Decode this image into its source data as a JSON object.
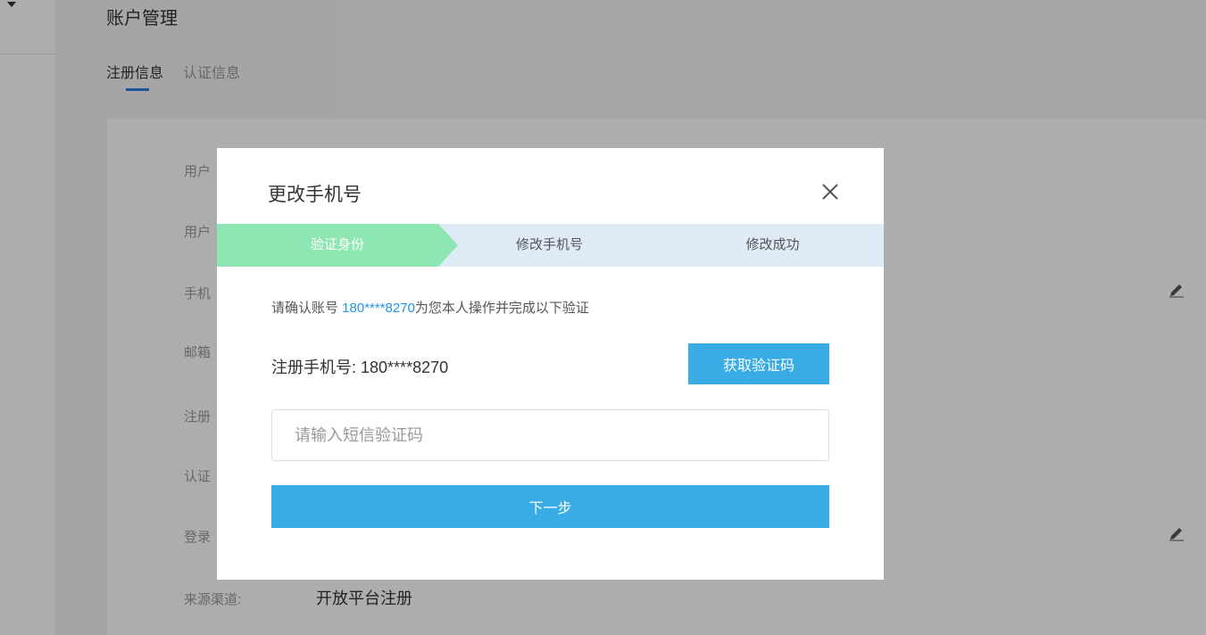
{
  "page": {
    "title": "账户管理",
    "tabs": [
      {
        "label": "注册信息",
        "active": true
      },
      {
        "label": "认证信息",
        "active": false
      }
    ],
    "fields": [
      {
        "label": "用户",
        "value": ""
      },
      {
        "label": "用户",
        "value": ""
      },
      {
        "label": "手机",
        "value": ""
      },
      {
        "label": "邮箱",
        "value": ""
      },
      {
        "label": "注册",
        "value": ""
      },
      {
        "label": "认证",
        "value": ""
      },
      {
        "label": "登录",
        "value": ""
      },
      {
        "label": "来源渠道:",
        "value": "开放平台注册"
      }
    ]
  },
  "modal": {
    "title": "更改手机号",
    "steps": [
      "验证身份",
      "修改手机号",
      "修改成功"
    ],
    "active_step": 0,
    "notice_prefix": "请确认账号 ",
    "notice_account": "180****8270",
    "notice_suffix": "为您本人操作并完成以下验证",
    "reg_phone_label": "注册手机号: ",
    "reg_phone_value": "180****8270",
    "get_code_label": "获取验证码",
    "code_placeholder": "请输入短信验证码",
    "next_label": "下一步"
  },
  "colors": {
    "accent_blue": "#39ace6",
    "step_active_green": "#8ee6b2",
    "step_bar_bg": "#deebf7",
    "account_link": "#2196e6",
    "tab_underline": "#2f7de1"
  },
  "icons": {
    "close": "close-icon",
    "edit": "pencil-icon",
    "caret": "caret-down-icon"
  }
}
